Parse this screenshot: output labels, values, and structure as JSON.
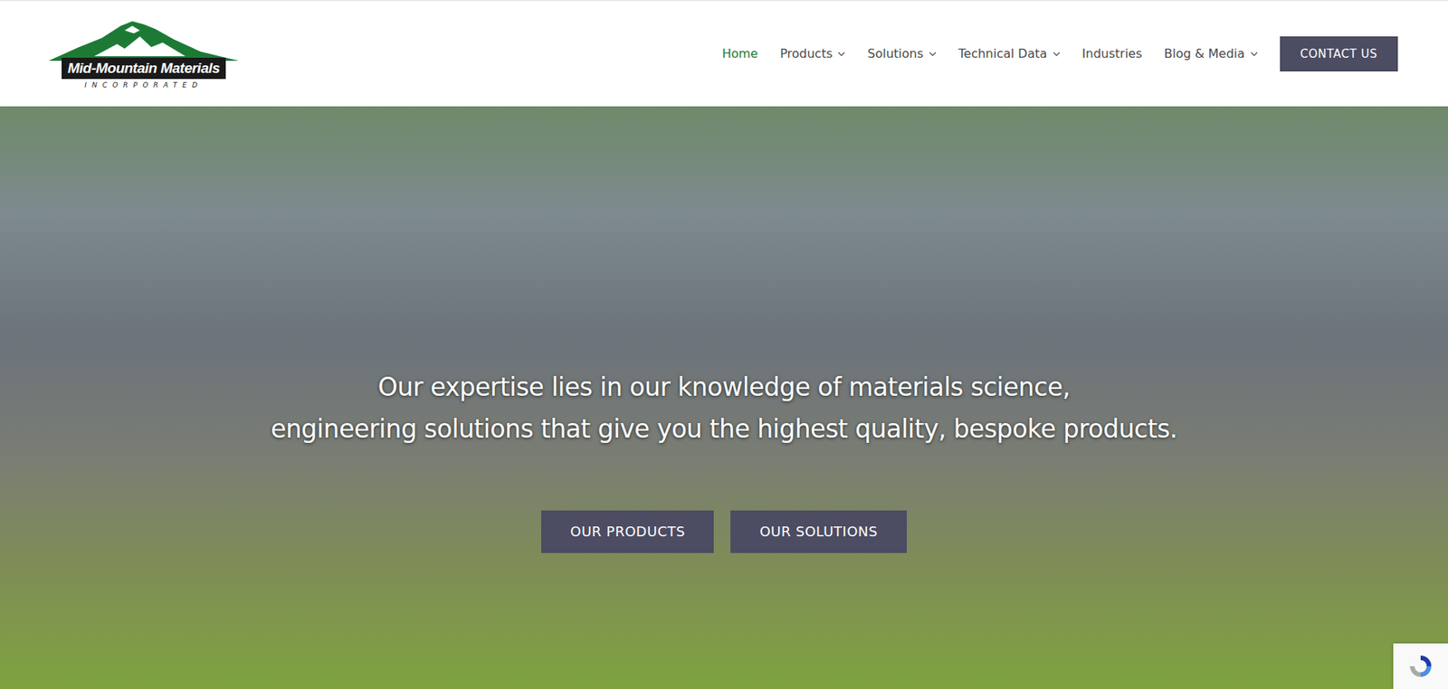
{
  "header": {
    "logo": {
      "name": "Mid-Mountain Materials",
      "tagline": "INCORPORATED"
    },
    "nav": [
      {
        "label": "Home",
        "selected": true,
        "dropdown": false
      },
      {
        "label": "Products",
        "selected": false,
        "dropdown": true
      },
      {
        "label": "Solutions",
        "selected": false,
        "dropdown": true
      },
      {
        "label": "Technical Data",
        "selected": false,
        "dropdown": true
      },
      {
        "label": "Industries",
        "selected": false,
        "dropdown": false
      },
      {
        "label": "Blog & Media",
        "selected": false,
        "dropdown": true
      }
    ],
    "cta": "CONTACT US"
  },
  "hero": {
    "lines": [
      "Our expertise lies in our knowledge of materials science,",
      "engineering solutions that give you the highest quality, bespoke products."
    ],
    "buttons": [
      "OUR PRODUCTS",
      "OUR SOLUTIONS"
    ]
  }
}
